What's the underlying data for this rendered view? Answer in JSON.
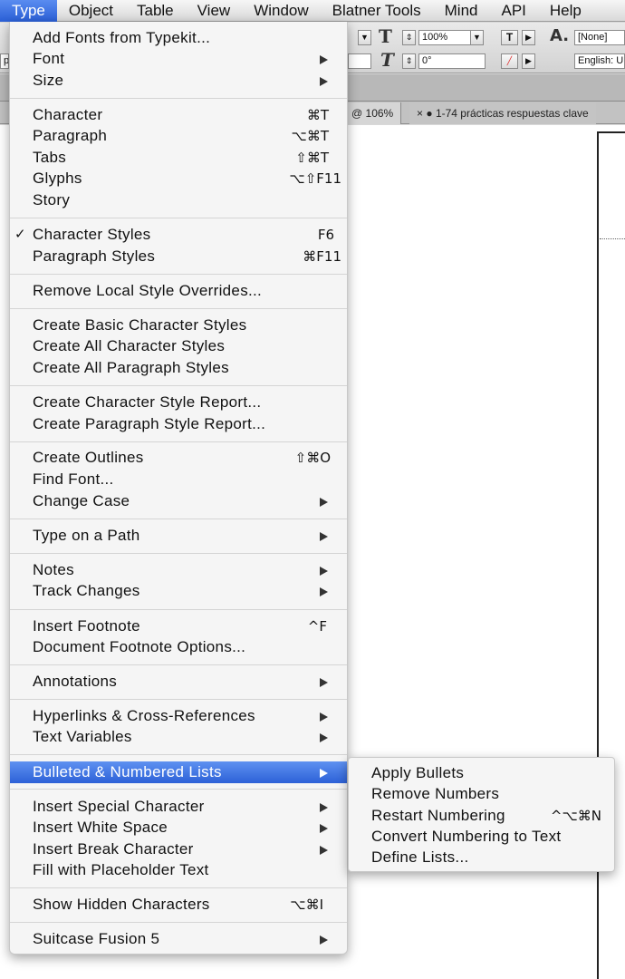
{
  "menubar": {
    "items": [
      "Type",
      "Object",
      "Table",
      "View",
      "Window",
      "Blatner Tools",
      "Mind",
      "API",
      "Help"
    ],
    "active": "Type"
  },
  "toolbar": {
    "leading_value": "100%",
    "skew_value": "0°",
    "char_style_value": "[None]",
    "language_value": "English: U",
    "left_stub_1": "pt",
    "left_stub_2": "pt"
  },
  "tabs": [
    {
      "label": "d @ 106%",
      "close": "×"
    },
    {
      "label": "1-74 prácticas respuestas clave",
      "close": "× ●"
    }
  ],
  "type_menu": {
    "items": [
      {
        "label": "Add Fonts from Typekit...",
        "shortcut": "",
        "submenu": false
      },
      {
        "label": "Font",
        "shortcut": "",
        "submenu": true
      },
      {
        "label": "Size",
        "shortcut": "",
        "submenu": true
      },
      {
        "label": "Character",
        "shortcut": "⌘T",
        "submenu": false
      },
      {
        "label": "Paragraph",
        "shortcut": "⌥⌘T",
        "submenu": false
      },
      {
        "label": "Tabs",
        "shortcut": "⇧⌘T",
        "submenu": false
      },
      {
        "label": "Glyphs",
        "shortcut": "⌥⇧F11",
        "submenu": false
      },
      {
        "label": "Story",
        "shortcut": "",
        "submenu": false
      },
      {
        "label": "Character Styles",
        "shortcut": "F6",
        "submenu": false,
        "checked": true,
        "check_mark": "✓"
      },
      {
        "label": "Paragraph Styles",
        "shortcut": "⌘F11",
        "submenu": false
      },
      {
        "label": "Remove Local Style Overrides...",
        "shortcut": "",
        "submenu": false
      },
      {
        "label": "Create Basic Character Styles",
        "shortcut": "",
        "submenu": false
      },
      {
        "label": "Create All Character Styles",
        "shortcut": "",
        "submenu": false
      },
      {
        "label": "Create All Paragraph Styles",
        "shortcut": "",
        "submenu": false
      },
      {
        "label": "Create Character Style Report...",
        "shortcut": "",
        "submenu": false
      },
      {
        "label": "Create Paragraph Style Report...",
        "shortcut": "",
        "submenu": false
      },
      {
        "label": "Create Outlines",
        "shortcut": "⇧⌘O",
        "submenu": false
      },
      {
        "label": "Find Font...",
        "shortcut": "",
        "submenu": false
      },
      {
        "label": "Change Case",
        "shortcut": "",
        "submenu": true
      },
      {
        "label": "Type on a Path",
        "shortcut": "",
        "submenu": true
      },
      {
        "label": "Notes",
        "shortcut": "",
        "submenu": true
      },
      {
        "label": "Track Changes",
        "shortcut": "",
        "submenu": true
      },
      {
        "label": "Insert Footnote",
        "shortcut": "^F",
        "submenu": false
      },
      {
        "label": "Document Footnote Options...",
        "shortcut": "",
        "submenu": false
      },
      {
        "label": "Annotations",
        "shortcut": "",
        "submenu": true
      },
      {
        "label": "Hyperlinks & Cross-References",
        "shortcut": "",
        "submenu": true
      },
      {
        "label": "Text Variables",
        "shortcut": "",
        "submenu": true
      },
      {
        "label": "Bulleted & Numbered Lists",
        "shortcut": "",
        "submenu": true,
        "highlighted": true
      },
      {
        "label": "Insert Special Character",
        "shortcut": "",
        "submenu": true
      },
      {
        "label": "Insert White Space",
        "shortcut": "",
        "submenu": true
      },
      {
        "label": "Insert Break Character",
        "shortcut": "",
        "submenu": true
      },
      {
        "label": "Fill with Placeholder Text",
        "shortcut": "",
        "submenu": false
      },
      {
        "label": "Show Hidden Characters",
        "shortcut": "⌥⌘I",
        "submenu": false
      },
      {
        "label": "Suitcase Fusion 5",
        "shortcut": "",
        "submenu": true
      }
    ]
  },
  "lists_submenu": {
    "items": [
      {
        "label": "Apply Bullets",
        "shortcut": ""
      },
      {
        "label": "Remove Numbers",
        "shortcut": ""
      },
      {
        "label": "Restart Numbering",
        "shortcut": "^⌥⌘N"
      },
      {
        "label": "Convert Numbering to Text",
        "shortcut": ""
      },
      {
        "label": "Define Lists...",
        "shortcut": ""
      }
    ]
  }
}
